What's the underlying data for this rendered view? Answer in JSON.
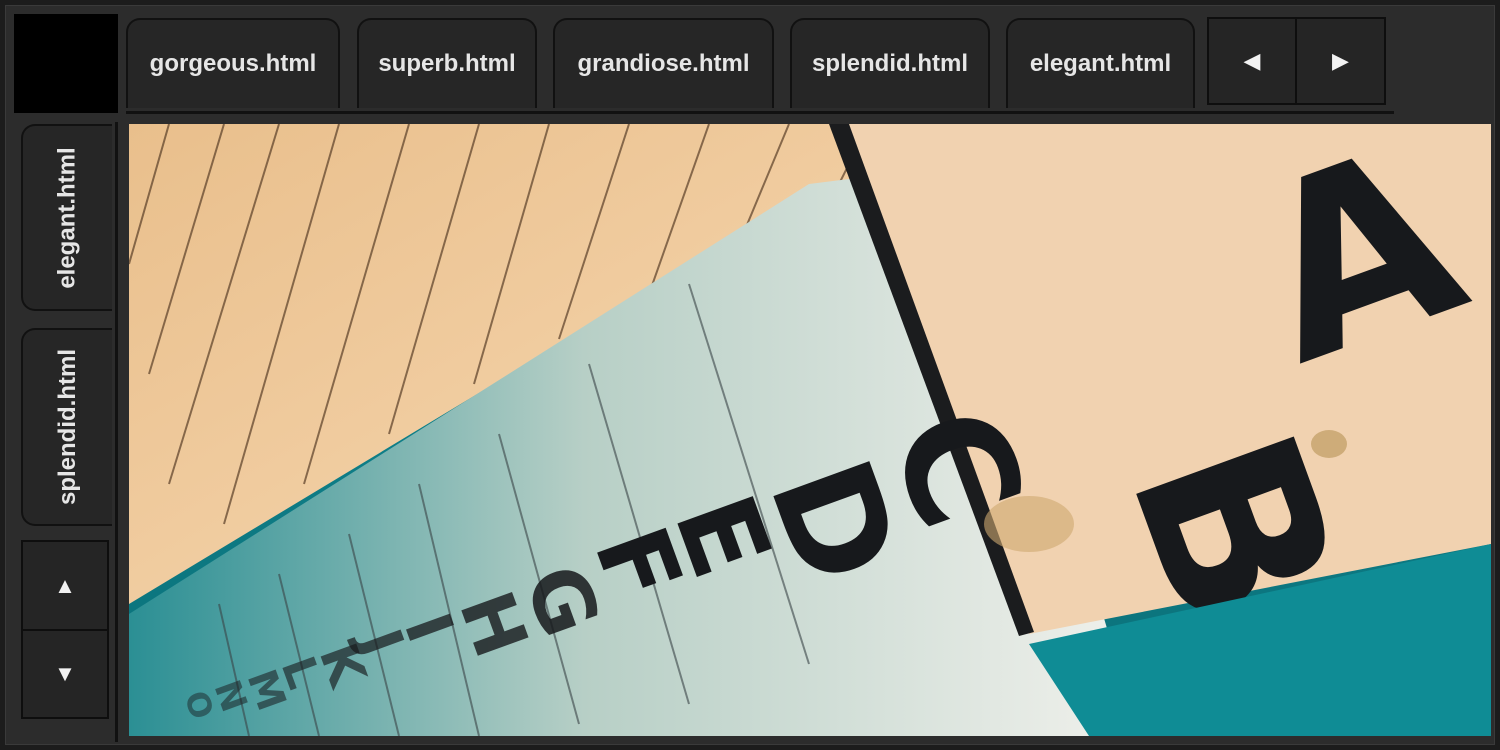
{
  "top_tabs": [
    {
      "label": "gorgeous.html"
    },
    {
      "label": "superb.html"
    },
    {
      "label": "grandiose.html"
    },
    {
      "label": "splendid.html"
    },
    {
      "label": "elegant.html"
    }
  ],
  "side_tabs": [
    {
      "label": "elegant.html"
    },
    {
      "label": "splendid.html"
    }
  ],
  "tab_scroll": {
    "left_icon": "◀",
    "right_icon": "▶"
  },
  "side_scroll": {
    "up_icon": "▲",
    "down_icon": "▼"
  },
  "photo": {
    "letters": [
      "A",
      "B",
      "C",
      "D",
      "E",
      "F",
      "G",
      "H",
      "I",
      "J",
      "K",
      "L",
      "M",
      "N",
      "O"
    ],
    "colors": {
      "wood": "#f0c99a",
      "pool": "#0e8a94",
      "tile": "#eef0ec",
      "ink": "#17191c"
    }
  }
}
